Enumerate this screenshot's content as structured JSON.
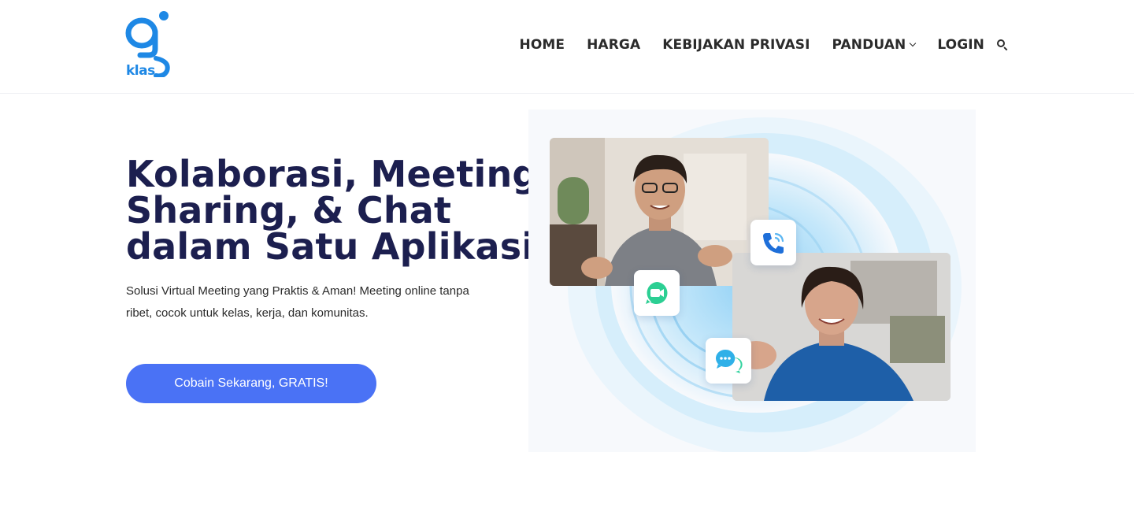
{
  "brand": {
    "logo_text": "klas"
  },
  "nav": {
    "items": [
      {
        "label": "HOME"
      },
      {
        "label": "HARGA"
      },
      {
        "label": "KEBIJAKAN PRIVASI"
      },
      {
        "label": "PANDUAN",
        "has_dropdown": true
      },
      {
        "label": "LOGIN"
      }
    ],
    "search_icon": "search-icon"
  },
  "hero": {
    "title_lines": [
      "Kolaborasi, Meeting,",
      "Sharing, & Chat",
      "dalam Satu Aplikasi!"
    ],
    "subtitle_lines": [
      "Solusi Virtual Meeting yang Praktis & Aman! Meeting online tanpa",
      "ribet, cocok untuk kelas, kerja, dan komunitas."
    ],
    "cta_label": "Cobain Sekarang, GRATIS!"
  },
  "illustration": {
    "floating_icons": [
      "phone-call-icon",
      "video-camera-icon",
      "chat-bubble-icon"
    ]
  },
  "colors": {
    "brand_blue": "#1e88e5",
    "title_navy": "#1c1f4f",
    "cta_blue": "#4a72f5",
    "nav_text": "#2b2b2b"
  }
}
